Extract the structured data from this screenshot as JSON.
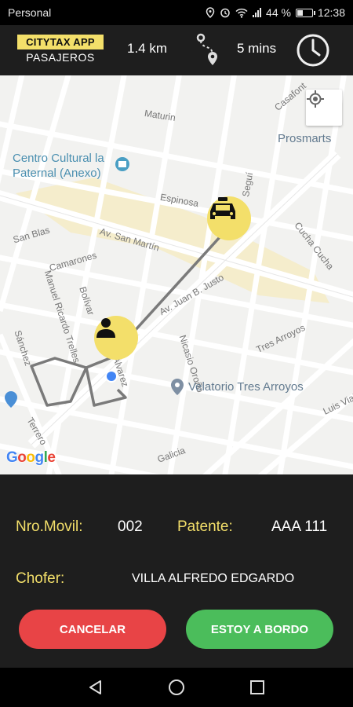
{
  "status_bar": {
    "carrier": "Personal",
    "battery": "44 %",
    "battery_level": 0.44,
    "time": "12:38",
    "icons": [
      "location-icon",
      "alarm-icon",
      "wifi-icon",
      "signal-icon",
      "battery-icon"
    ]
  },
  "header": {
    "brand": "CITYTAX APP",
    "subtitle": "PASAJEROS",
    "distance": "1.4 km",
    "eta": "5 mins",
    "icons": [
      "route-icon",
      "clock-icon"
    ]
  },
  "map": {
    "streets": [
      "Maturin",
      "Espinosa",
      "Av. San Martín",
      "San Blas",
      "Camarones",
      "Manuel Ricardo Trelles",
      "Sánchez",
      "Av. Juan B. Justo",
      "Nicasio Oroño",
      "Tres Arroyos",
      "Cucha Cucha",
      "Luis Viale",
      "Galicia",
      "Terrero",
      "Casafont",
      "Seguí",
      "Alvarez",
      "Bolívar"
    ],
    "pois": {
      "cultural_center": "Centro Cultural la Paternal (Anexo)",
      "store": "Prosmarts",
      "funeral_home": "Velatorio Tres Arroyos"
    },
    "attribution": "Google",
    "icons": [
      "taxi-icon",
      "person-icon",
      "my-location-icon",
      "user-location-dot"
    ]
  },
  "trip": {
    "movil_label": "Nro.Movil:",
    "movil_value": "002",
    "plate_label": "Patente:",
    "plate_value": "AAA 111",
    "driver_label": "Chofer:",
    "driver_value": "VILLA ALFREDO EDGARDO"
  },
  "actions": {
    "cancel": "CANCELAR",
    "on_board": "ESTOY A BORDO"
  },
  "colors": {
    "accent_yellow": "#f3df6a",
    "cancel_red": "#e84446",
    "board_green": "#4bbd5b",
    "background": "#1e1e1e"
  },
  "navigation": {
    "icons": [
      "back-icon",
      "home-icon",
      "recents-icon"
    ]
  }
}
